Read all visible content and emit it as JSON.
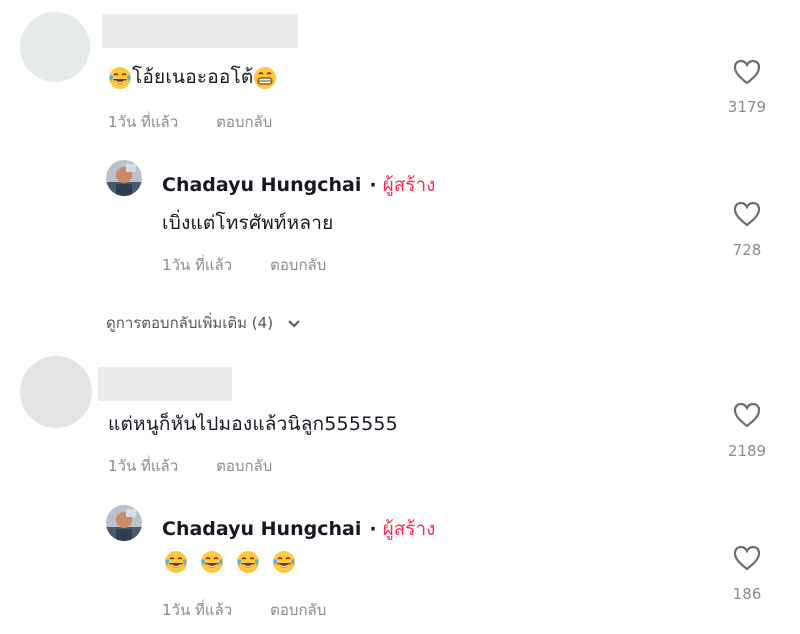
{
  "comments": [
    {
      "text": "โอ้ยเนอะออโต้",
      "time": "1วัน ที่แล้ว",
      "reply_label": "ตอบกลับ",
      "likes": "3179",
      "emoji_prefix": "laugh-cry-emoji",
      "emoji_suffix": "grin-emoji"
    },
    {
      "author": "Chadayu Hungchai",
      "separator": "·",
      "badge": "ผู้สร้าง",
      "text": "เบิ่งแต่โทรศัพท์หลาย",
      "time": "1วัน ที่แล้ว",
      "reply_label": "ตอบกลับ",
      "likes": "728"
    },
    {
      "text": "แต่หนูก็หันไปมองแล้วนิลูก555555",
      "time": "1วัน ที่แล้ว",
      "reply_label": "ตอบกลับ",
      "likes": "2189"
    },
    {
      "author": "Chadayu Hungchai",
      "separator": "·",
      "badge": "ผู้สร้าง",
      "emojis": [
        "laugh-cry-emoji",
        "laugh-cry-emoji",
        "laugh-cry-emoji",
        "laugh-cry-emoji"
      ],
      "time": "1วัน ที่แล้ว",
      "reply_label": "ตอบกลับ",
      "likes": "186"
    }
  ],
  "view_more": {
    "label": "ดูการตอบกลับเพิ่มเติม (4)",
    "icon": "chevron-down-icon"
  },
  "colors": {
    "creator_badge": "#fe2c55",
    "meta_text": "#8a8b91",
    "main_text": "#161823"
  }
}
